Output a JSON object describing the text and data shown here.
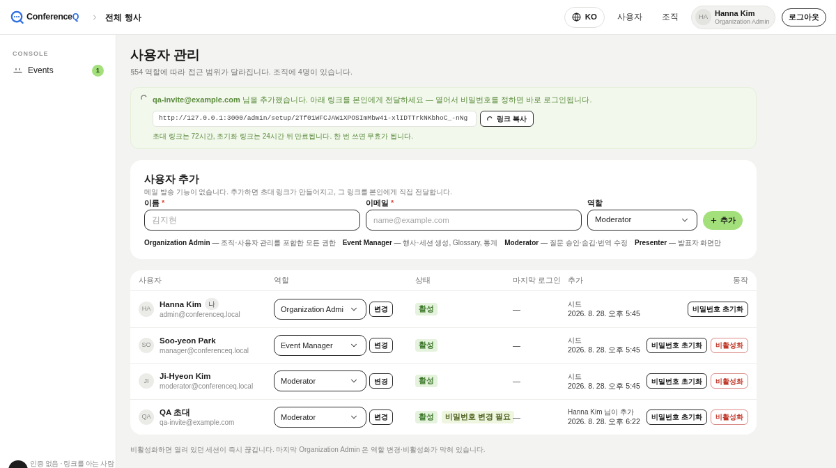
{
  "topbar": {
    "brand": {
      "text": "Conference",
      "accent": "Q"
    },
    "breadcrumb": "전체 행사",
    "language": "KO",
    "nav": [
      "사용자",
      "조직"
    ],
    "user": {
      "initials": "HA",
      "name": "Hanna Kim",
      "role": "Organization Admin"
    },
    "logout": "로그아웃"
  },
  "sidebar": {
    "section": "CONSOLE",
    "items": [
      {
        "label": "Events",
        "count": "1"
      }
    ],
    "footer": "인증 없음 · 링크를 아는 사람"
  },
  "page": {
    "title": "사용자 관리",
    "subtitle": "§54 역할에 따라 접근 범위가 달라집니다. 조직에 4명이 있습니다."
  },
  "notice": {
    "message": "**qa-invite@example.com** 님을 추가했습니다. 아래 링크를 본인에게 전달하세요 — 열어서 비밀번호를 정하면 바로 로그인됩니다.",
    "link": "http://127.0.0.1:3000/admin/setup/2Tf01WFCJAWiXPOSImMbw41-xlIDTTrkNKbhoC_-nNg",
    "copy_button": "링크 복사",
    "note": "초대 링크는 72시간, 초기화 링크는 24시간 뒤 만료됩니다. 한 번 쓰면 무효가 됩니다."
  },
  "add_user": {
    "title": "사용자 추가",
    "description": "메일 발송 기능이 없습니다. 추가하면 초대 링크가 만들어지고, 그 링크를 본인에게 직접 전달합니다.",
    "required_mark": "*",
    "fields": [
      {
        "kind": "text",
        "label": "이름",
        "required": true,
        "placeholder": "김지현"
      },
      {
        "kind": "text",
        "label": "이메일",
        "required": true,
        "placeholder": "name@example.com"
      },
      {
        "kind": "select",
        "label": "역할",
        "required": false,
        "value": "Moderator"
      }
    ],
    "submit": "추가",
    "role_legend": [
      "**Organization Admin** — 조직·사용자 관리를 포함한 모든 권한",
      "**Event Manager** — 행사·세션 생성, Glossary, 통계",
      "**Moderator** — 질문 승인·숨김·번역 수정",
      "**Presenter** — 발표자 화면만"
    ]
  },
  "users_table": {
    "columns": [
      "사용자",
      "역할",
      "상태",
      "마지막 로그인",
      "추가",
      "동작"
    ],
    "rows": [
      {
        "initials": "HA",
        "name": "Hanna Kim",
        "tag": "나",
        "email": "admin@conferenceq.local",
        "role": "Organization Admi",
        "change_button": "변경",
        "statuses": [
          {
            "kind": "active",
            "label": "활성"
          }
        ],
        "last_login": "—",
        "added_by": "시드",
        "added_at": "2026. 8. 28. 오후 5:45",
        "actions": [
          {
            "kind": "reset",
            "label": "비밀번호 초기화"
          }
        ]
      },
      {
        "initials": "SO",
        "name": "Soo-yeon Park",
        "email": "manager@conferenceq.local",
        "role": "Event Manager",
        "change_button": "변경",
        "statuses": [
          {
            "kind": "active",
            "label": "활성"
          }
        ],
        "last_login": "—",
        "added_by": "시드",
        "added_at": "2026. 8. 28. 오후 5:45",
        "actions": [
          {
            "kind": "reset",
            "label": "비밀번호 초기화"
          },
          {
            "kind": "deactivate",
            "label": "비활성화"
          }
        ]
      },
      {
        "initials": "JI",
        "name": "Ji-Hyeon Kim",
        "email": "moderator@conferenceq.local",
        "role": "Moderator",
        "change_button": "변경",
        "statuses": [
          {
            "kind": "active",
            "label": "활성"
          }
        ],
        "last_login": "—",
        "added_by": "시드",
        "added_at": "2026. 8. 28. 오후 5:45",
        "actions": [
          {
            "kind": "reset",
            "label": "비밀번호 초기화"
          },
          {
            "kind": "deactivate",
            "label": "비활성화"
          }
        ]
      },
      {
        "initials": "QA",
        "name": "QA 초대",
        "email": "qa-invite@example.com",
        "role": "Moderator",
        "change_button": "변경",
        "statuses": [
          {
            "kind": "active",
            "label": "활성"
          },
          {
            "kind": "warning",
            "label": "비밀번호 변경 필요"
          }
        ],
        "last_login": "—",
        "added_by": "Hanna Kim 님이 추가",
        "added_at": "2026. 8. 28. 오후 6:22",
        "actions": [
          {
            "kind": "reset",
            "label": "비밀번호 초기화"
          },
          {
            "kind": "deactivate",
            "label": "비활성화"
          }
        ]
      }
    ]
  },
  "footer_note": "비활성화하면 열려 있던 세션이 즉시 끊깁니다. 마지막 Organization Admin 은 역할 변경·비활성화가 막혀 있습니다."
}
